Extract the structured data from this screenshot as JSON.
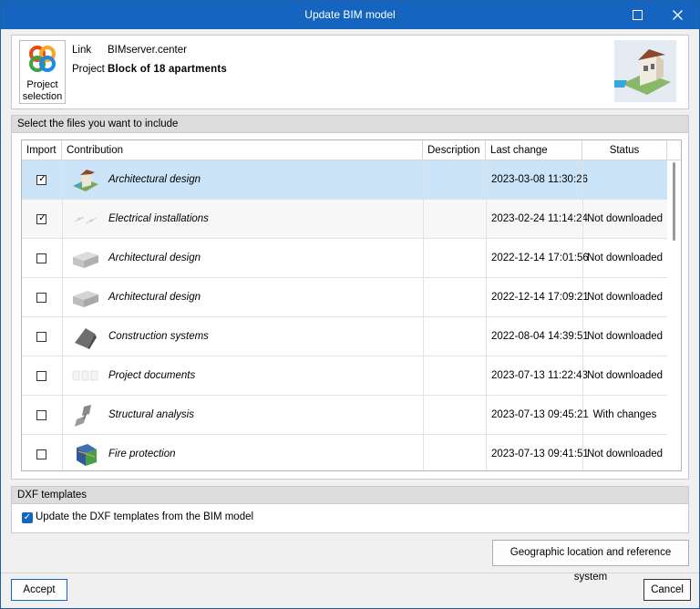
{
  "window": {
    "title": "Update BIM model"
  },
  "header": {
    "project_selection_line1": "Project",
    "project_selection_line2": "selection",
    "link_label": "Link",
    "link_value": "BIMserver.center",
    "project_label": "Project",
    "project_value": "Block of 18 apartments"
  },
  "files_section": {
    "title": "Select the files you want to include",
    "columns": [
      "Import",
      "Contribution",
      "Description",
      "Last change",
      "Status"
    ],
    "rows": [
      {
        "checked": true,
        "contribution": "Architectural design",
        "description": "",
        "last_change": "2023-03-08 11:30:26",
        "status": "",
        "icon": "house-model-icon"
      },
      {
        "checked": true,
        "contribution": "Electrical installations",
        "description": "",
        "last_change": "2023-02-24 11:14:24",
        "status": "Not downloaded",
        "icon": "electrical-model-icon"
      },
      {
        "checked": false,
        "contribution": "Architectural design",
        "description": "",
        "last_change": "2022-12-14 17:01:56",
        "status": "Not downloaded",
        "icon": "building-model-icon"
      },
      {
        "checked": false,
        "contribution": "Architectural design",
        "description": "",
        "last_change": "2022-12-14 17:09:21",
        "status": "Not downloaded",
        "icon": "building-model-icon"
      },
      {
        "checked": false,
        "contribution": "Construction systems",
        "description": "",
        "last_change": "2022-08-04 14:39:51",
        "status": "Not downloaded",
        "icon": "construction-model-icon"
      },
      {
        "checked": false,
        "contribution": "Project documents",
        "description": "",
        "last_change": "2023-07-13 11:22:43",
        "status": "Not downloaded",
        "icon": "documents-icon"
      },
      {
        "checked": false,
        "contribution": "Structural analysis",
        "description": "",
        "last_change": "2023-07-13 09:45:21",
        "status": "With changes",
        "icon": "structure-model-icon"
      },
      {
        "checked": false,
        "contribution": "Fire protection",
        "description": "",
        "last_change": "2023-07-13 09:41:51",
        "status": "Not downloaded",
        "icon": "fire-protection-model-icon"
      }
    ]
  },
  "dxf_section": {
    "title": "DXF templates",
    "checkbox_label": "Update the DXF templates from the BIM model",
    "checked": true
  },
  "buttons": {
    "geo": "Geographic location and reference system",
    "accept": "Accept",
    "cancel": "Cancel"
  },
  "colors": {
    "titlebar": "#1565c0",
    "selected_row": "#cce4f7"
  }
}
